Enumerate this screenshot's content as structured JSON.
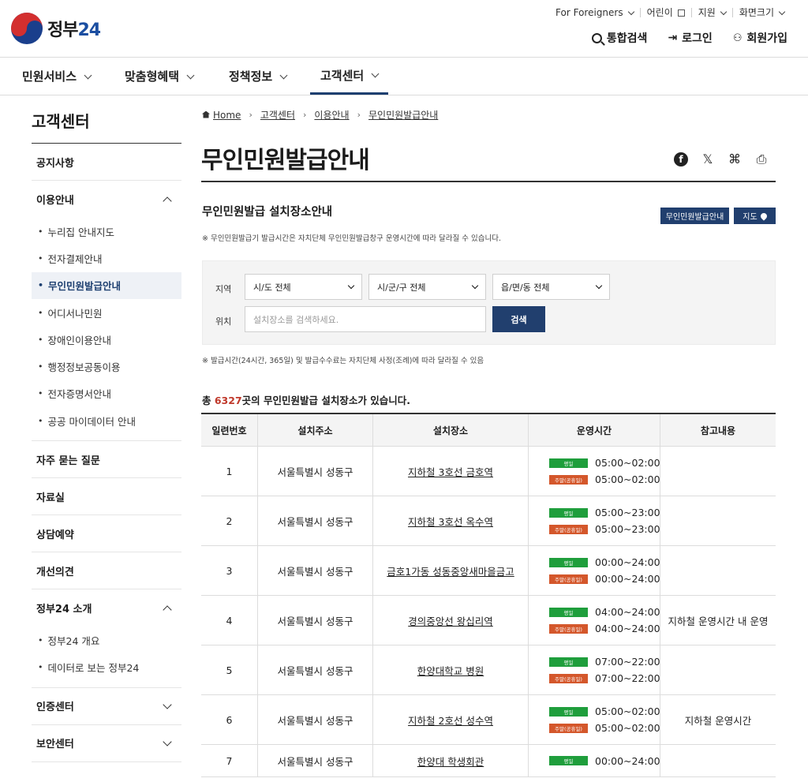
{
  "header": {
    "logo_text": "정부",
    "logo_num": "24",
    "util": [
      {
        "label": "For Foreigners",
        "icon": "chevron-down-icon"
      },
      {
        "label": "어린이",
        "icon": "external-link-icon"
      },
      {
        "label": "지원",
        "icon": "chevron-down-icon"
      },
      {
        "label": "화면크기",
        "icon": "chevron-down-icon"
      }
    ],
    "actions": {
      "search": "통합검색",
      "login": "로그인",
      "join": "회원가입"
    }
  },
  "gnb": [
    {
      "label": "민원서비스"
    },
    {
      "label": "맞춤형혜택"
    },
    {
      "label": "정책정보"
    },
    {
      "label": "고객센터",
      "active": true
    }
  ],
  "sidebar": {
    "title": "고객센터",
    "items": [
      {
        "label": "공지사항"
      },
      {
        "label": "이용안내",
        "sub": [
          "누리집 안내지도",
          "전자결제안내",
          "무인민원발급안내",
          "어디서나민원",
          "장애인이용안내",
          "행정정보공동이용",
          "전자증명서안내",
          "공공 마이데이터 안내"
        ],
        "active_sub": "무인민원발급안내"
      },
      {
        "label": "자주 묻는 질문"
      },
      {
        "label": "자료실"
      },
      {
        "label": "상담예약"
      },
      {
        "label": "개선의견"
      },
      {
        "label": "정부24 소개",
        "sub": [
          "정부24 개요",
          "데이터로 보는 정부24"
        ]
      },
      {
        "label": "인증센터"
      },
      {
        "label": "보안센터"
      }
    ]
  },
  "breadcrumb": [
    "Home",
    "고객센터",
    "이용안내",
    "무인민원발급안내"
  ],
  "page_title": "무인민원발급안내",
  "section": {
    "title": "무인민원발급 설치장소안내",
    "btn_guide": "무인민원발급안내",
    "btn_map": "지도",
    "note": "※ 무인민원발급기 발급시간은 자치단체 무인민원발급창구 운영시간에 따라 달라질 수 있습니다."
  },
  "filter": {
    "region_label": "지역",
    "sido": "시/도 전체",
    "sigungu": "시/군/구 전체",
    "eupmyeondong": "읍/면/동 전체",
    "location_label": "위치",
    "location_placeholder": "설치장소를 검색하세요.",
    "search_btn": "검색"
  },
  "note2": "※ 발급시간(24시간, 365일) 및 발급수수료는 자치단체 사정(조례)에 따라 달라질 수 있음",
  "total": {
    "prefix": "총 ",
    "count": "6327",
    "suffix": "곳의 무인민원발급 설치장소가 있습니다."
  },
  "table": {
    "headers": [
      "일련번호",
      "설치주소",
      "설치장소",
      "운영시간",
      "참고내용"
    ],
    "weekday_badge": "평일",
    "holiday_badge": "주말(공휴일)",
    "rows": [
      {
        "no": "1",
        "addr": "서울특별시 성동구",
        "place": "지하철 3호선 금호역",
        "weekday": "05:00~02:00",
        "holiday": "05:00~02:00",
        "note": ""
      },
      {
        "no": "2",
        "addr": "서울특별시 성동구",
        "place": "지하철 3호선 옥수역",
        "weekday": "05:00~23:00",
        "holiday": "05:00~23:00",
        "note": ""
      },
      {
        "no": "3",
        "addr": "서울특별시 성동구",
        "place": "금호1가동 성동중앙새마을금고",
        "weekday": "00:00~24:00",
        "holiday": "00:00~24:00",
        "note": ""
      },
      {
        "no": "4",
        "addr": "서울특별시 성동구",
        "place": "경의중앙선 왕십리역",
        "weekday": "04:00~24:00",
        "holiday": "04:00~24:00",
        "note": "지하철 운영시간 내 운영"
      },
      {
        "no": "5",
        "addr": "서울특별시 성동구",
        "place": "한양대학교 병원",
        "weekday": "07:00~22:00",
        "holiday": "07:00~22:00",
        "note": ""
      },
      {
        "no": "6",
        "addr": "서울특별시 성동구",
        "place": "지하철 2호선 성수역",
        "weekday": "05:00~02:00",
        "holiday": "05:00~02:00",
        "note": "지하철 운영시간"
      },
      {
        "no": "7",
        "addr": "서울특별시 성동구",
        "place": "한양대 학생회관",
        "weekday": "00:00~24:00",
        "holiday": "",
        "note": ""
      }
    ]
  }
}
